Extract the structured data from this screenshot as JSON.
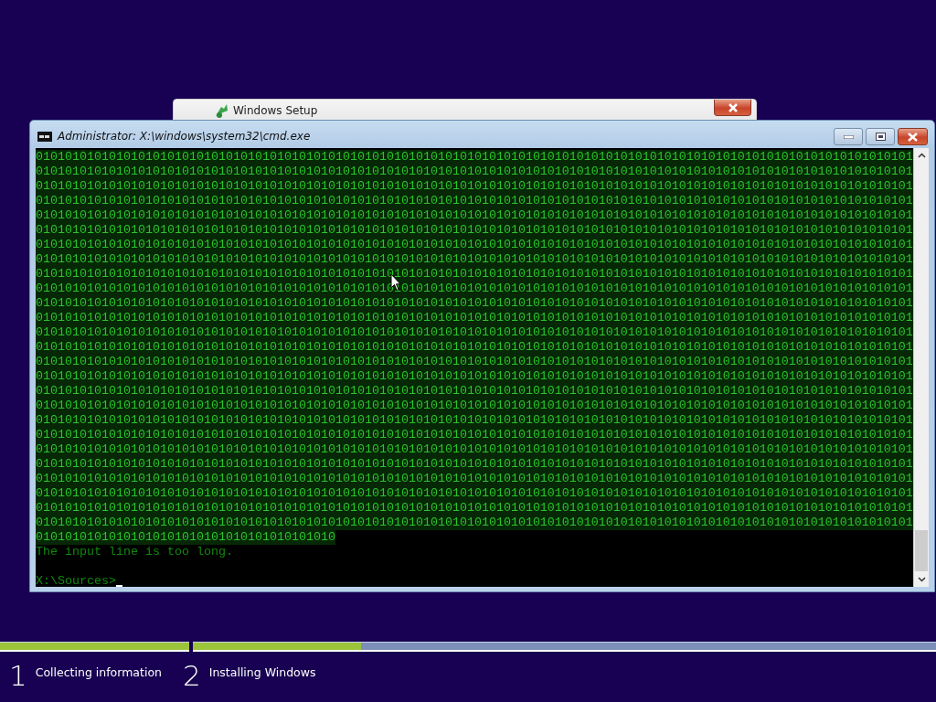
{
  "background_window": {
    "title": "Windows Setup"
  },
  "console_window": {
    "title": "Administrator: X:\\windows\\system32\\cmd.exe",
    "lines": [
      {
        "text": "010101010101010101010101010101010101010101010101010101010101010101010101010101010101010101010101010101010101010101010101",
        "highlighted": true
      },
      {
        "text": "010101010101010101010101010101010101010101010101010101010101010101010101010101010101010101010101010101010101010101010101",
        "highlighted": true
      },
      {
        "text": "010101010101010101010101010101010101010101010101010101010101010101010101010101010101010101010101010101010101010101010101",
        "highlighted": true
      },
      {
        "text": "010101010101010101010101010101010101010101010101010101010101010101010101010101010101010101010101010101010101010101010101",
        "highlighted": true
      },
      {
        "text": "010101010101010101010101010101010101010101010101010101010101010101010101010101010101010101010101010101010101010101010101",
        "highlighted": true
      },
      {
        "text": "010101010101010101010101010101010101010101010101010101010101010101010101010101010101010101010101010101010101010101010101",
        "highlighted": true
      },
      {
        "text": "010101010101010101010101010101010101010101010101010101010101010101010101010101010101010101010101010101010101010101010101",
        "highlighted": true
      },
      {
        "text": "010101010101010101010101010101010101010101010101010101010101010101010101010101010101010101010101010101010101010101010101",
        "highlighted": true
      },
      {
        "text": "010101010101010101010101010101010101010101010101010101010101010101010101010101010101010101010101010101010101010101010101",
        "highlighted": true
      },
      {
        "text": "010101010101010101010101010101010101010101010101010101010101010101010101010101010101010101010101010101010101010101010101",
        "highlighted": true
      },
      {
        "text": "010101010101010101010101010101010101010101010101010101010101010101010101010101010101010101010101010101010101010101010101",
        "highlighted": true
      },
      {
        "text": "010101010101010101010101010101010101010101010101010101010101010101010101010101010101010101010101010101010101010101010101",
        "highlighted": true
      },
      {
        "text": "010101010101010101010101010101010101010101010101010101010101010101010101010101010101010101010101010101010101010101010101",
        "highlighted": true
      },
      {
        "text": "010101010101010101010101010101010101010101010101010101010101010101010101010101010101010101010101010101010101010101010101",
        "highlighted": true
      },
      {
        "text": "010101010101010101010101010101010101010101010101010101010101010101010101010101010101010101010101010101010101010101010101",
        "highlighted": true
      },
      {
        "text": "010101010101010101010101010101010101010101010101010101010101010101010101010101010101010101010101010101010101010101010101",
        "highlighted": true
      },
      {
        "text": "010101010101010101010101010101010101010101010101010101010101010101010101010101010101010101010101010101010101010101010101",
        "highlighted": true
      },
      {
        "text": "010101010101010101010101010101010101010101010101010101010101010101010101010101010101010101010101010101010101010101010101",
        "highlighted": true
      },
      {
        "text": "010101010101010101010101010101010101010101010101010101010101010101010101010101010101010101010101010101010101010101010101",
        "highlighted": true
      },
      {
        "text": "010101010101010101010101010101010101010101010101010101010101010101010101010101010101010101010101010101010101010101010101",
        "highlighted": true
      },
      {
        "text": "010101010101010101010101010101010101010101010101010101010101010101010101010101010101010101010101010101010101010101010101",
        "highlighted": true
      },
      {
        "text": "010101010101010101010101010101010101010101010101010101010101010101010101010101010101010101010101010101010101010101010101",
        "highlighted": true
      },
      {
        "text": "010101010101010101010101010101010101010101010101010101010101010101010101010101010101010101010101010101010101010101010101",
        "highlighted": true
      },
      {
        "text": "010101010101010101010101010101010101010101010101010101010101010101010101010101010101010101010101010101010101010101010101",
        "highlighted": true
      },
      {
        "text": "010101010101010101010101010101010101010101010101010101010101010101010101010101010101010101010101010101010101010101010101",
        "highlighted": true
      },
      {
        "text": "010101010101010101010101010101010101010101010101010101010101010101010101010101010101010101010101010101010101010101010101",
        "highlighted": true
      },
      {
        "text": "01010101010101010101010101010101010101010",
        "highlighted": true
      },
      {
        "text": "The input line is too long.",
        "highlighted": false
      }
    ],
    "prompt": "X:\\Sources>"
  },
  "steps": [
    {
      "number": "1",
      "label": "Collecting information",
      "level": 1
    },
    {
      "number": "2",
      "label": "Installing Windows",
      "level": 0.226
    }
  ]
}
